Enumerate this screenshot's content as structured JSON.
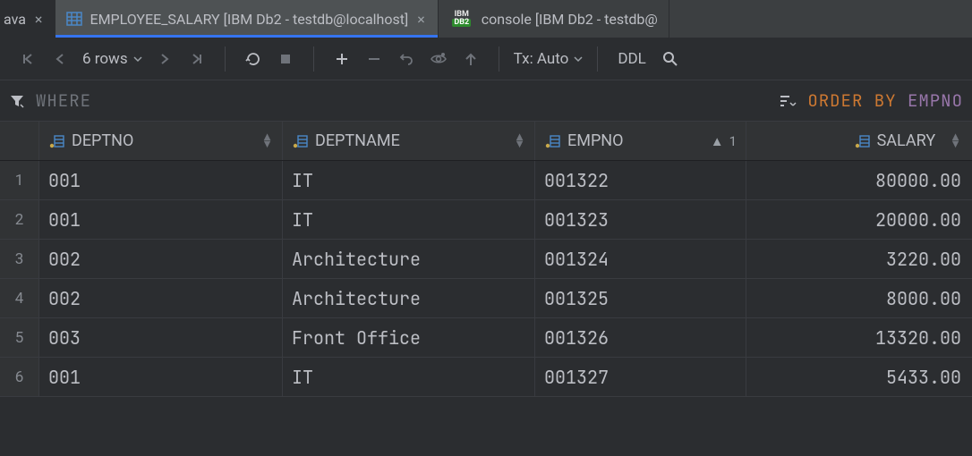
{
  "tabs": {
    "prev_partial": "ava",
    "active": "EMPLOYEE_SALARY [IBM Db2 - testdb@localhost]",
    "next": "console [IBM Db2 - testdb@"
  },
  "toolbar": {
    "rows_label": "6 rows",
    "tx_label": "Tx: Auto",
    "ddl_label": "DDL"
  },
  "filter": {
    "where_placeholder": "WHERE",
    "order_kw": "ORDER",
    "by_kw": "BY",
    "order_col": "EMPNO"
  },
  "columns": [
    {
      "name": "DEPTNO",
      "cls": "c-deptno"
    },
    {
      "name": "DEPTNAME",
      "cls": "c-deptname"
    },
    {
      "name": "EMPNO",
      "cls": "c-empno",
      "sort": 1
    },
    {
      "name": "SALARY",
      "cls": "c-salary"
    }
  ],
  "rows": [
    {
      "n": "1",
      "DEPTNO": "001",
      "DEPTNAME": "IT",
      "EMPNO": "001322",
      "SALARY": "80000.00"
    },
    {
      "n": "2",
      "DEPTNO": "001",
      "DEPTNAME": "IT",
      "EMPNO": "001323",
      "SALARY": "20000.00"
    },
    {
      "n": "3",
      "DEPTNO": "002",
      "DEPTNAME": "Architecture",
      "EMPNO": "001324",
      "SALARY": "3220.00"
    },
    {
      "n": "4",
      "DEPTNO": "002",
      "DEPTNAME": "Architecture",
      "EMPNO": "001325",
      "SALARY": "8000.00"
    },
    {
      "n": "5",
      "DEPTNO": "003",
      "DEPTNAME": "Front Office",
      "EMPNO": "001326",
      "SALARY": "13320.00"
    },
    {
      "n": "6",
      "DEPTNO": "001",
      "DEPTNAME": "IT",
      "EMPNO": "001327",
      "SALARY": "5433.00"
    }
  ]
}
